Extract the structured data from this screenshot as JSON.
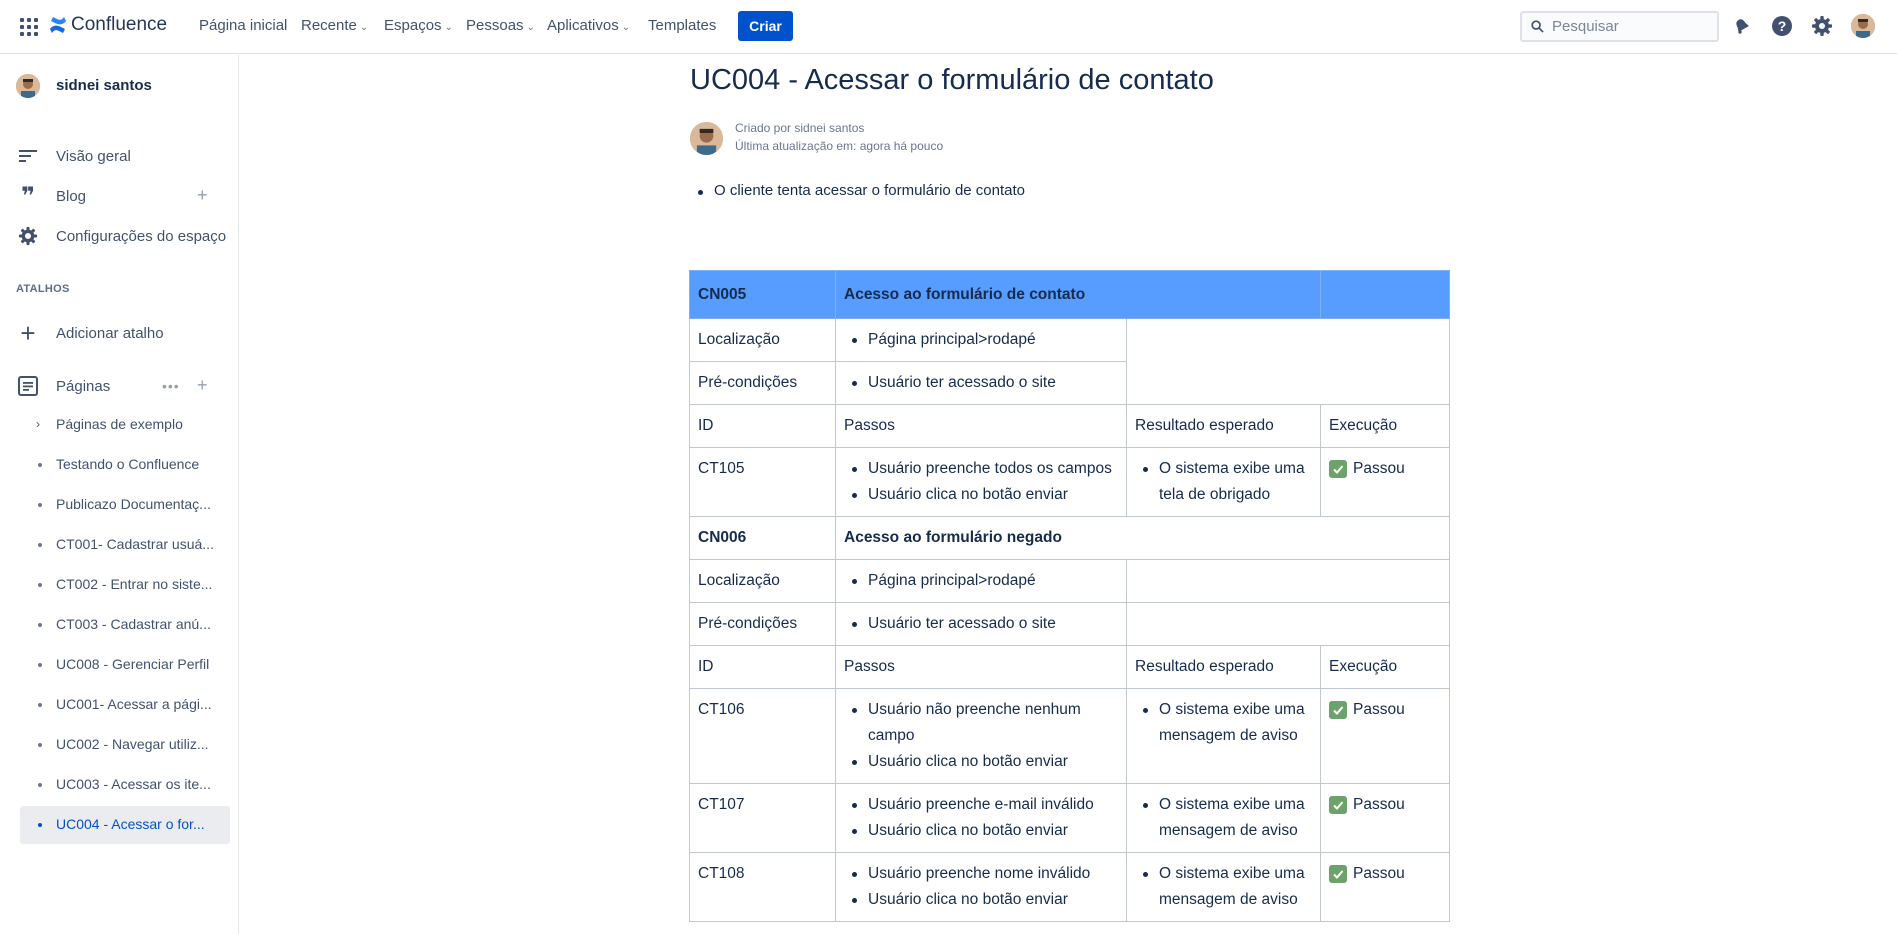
{
  "topnav": {
    "logo": "Confluence",
    "items": [
      {
        "label": "Página inicial",
        "dropdown": false
      },
      {
        "label": "Recente",
        "dropdown": true
      },
      {
        "label": "Espaços",
        "dropdown": true
      },
      {
        "label": "Pessoas",
        "dropdown": true
      },
      {
        "label": "Aplicativos",
        "dropdown": true
      },
      {
        "label": "Templates",
        "dropdown": false
      }
    ],
    "create_label": "Criar",
    "search_placeholder": "Pesquisar",
    "icons": [
      "notifications-icon",
      "help-icon",
      "settings-icon",
      "profile-avatar"
    ]
  },
  "sidebar": {
    "user": "sidnei santos",
    "nav": [
      {
        "label": "Visão geral",
        "icon": "overview-icon"
      },
      {
        "label": "Blog",
        "icon": "quote-icon"
      },
      {
        "label": "Configurações do espaço",
        "icon": "gear-icon"
      }
    ],
    "shortcuts_heading": "ATALHOS",
    "add_shortcut": "Adicionar atalho",
    "pages_heading": "Páginas",
    "pages": [
      {
        "label": "Páginas de exemplo",
        "expandable": true
      },
      {
        "label": "Testando o Confluence"
      },
      {
        "label": "Publicazo Documentaç..."
      },
      {
        "label": "CT001- Cadastrar usuá..."
      },
      {
        "label": "CT002 - Entrar no siste..."
      },
      {
        "label": "CT003 - Cadastrar anú..."
      },
      {
        "label": "UC008 - Gerenciar Perfil"
      },
      {
        "label": "UC001- Acessar a pági..."
      },
      {
        "label": "UC002 - Navegar utiliz..."
      },
      {
        "label": "UC003 - Acessar os ite..."
      },
      {
        "label": "UC004 - Acessar o for...",
        "active": true
      }
    ]
  },
  "page": {
    "title": "UC004 - Acessar o formulário de contato",
    "created_by": "Criado por sidnei santos",
    "last_updated": "Última atualização em: agora há pouco",
    "summary": "O cliente tenta acessar o formulário de contato"
  },
  "table": {
    "cn005": {
      "id": "CN005",
      "title": "Acesso ao formulário de contato",
      "localizacao_label": "Localização",
      "localizacao": "Página principal>rodapé",
      "precond_label": "Pré-condições",
      "precond": "Usuário ter acessado o site"
    },
    "headers": {
      "id": "ID",
      "passos": "Passos",
      "resultado": "Resultado esperado",
      "execucao": "Execução"
    },
    "ct105": {
      "id": "CT105",
      "steps": [
        "Usuário preenche todos os campos",
        "Usuário clica no botão enviar"
      ],
      "result": "O sistema exibe uma tela de obrigado",
      "status": "Passou"
    },
    "cn006": {
      "id": "CN006",
      "title": "Acesso ao formulário negado",
      "localizacao_label": "Localização",
      "localizacao": "Página principal>rodapé",
      "precond_label": "Pré-condições",
      "precond": "Usuário ter acessado o site"
    },
    "ct106": {
      "id": "CT106",
      "steps": [
        "Usuário não preenche nenhum campo",
        "Usuário clica no botão enviar"
      ],
      "result": "O sistema exibe uma mensagem de aviso",
      "status": "Passou"
    },
    "ct107": {
      "id": "CT107",
      "steps": [
        "Usuário preenche e-mail inválido",
        "Usuário clica no botão enviar"
      ],
      "result": "O sistema exibe uma mensagem de aviso",
      "status": "Passou"
    },
    "ct108": {
      "id": "CT108",
      "steps": [
        "Usuário preenche nome inválido",
        "Usuário clica no botão enviar"
      ],
      "result": "O sistema exibe uma mensagem de aviso",
      "status": "Passou"
    }
  },
  "colors": {
    "accent": "#0052cc",
    "table_header": "#579dff",
    "check": "#6ba36b"
  }
}
